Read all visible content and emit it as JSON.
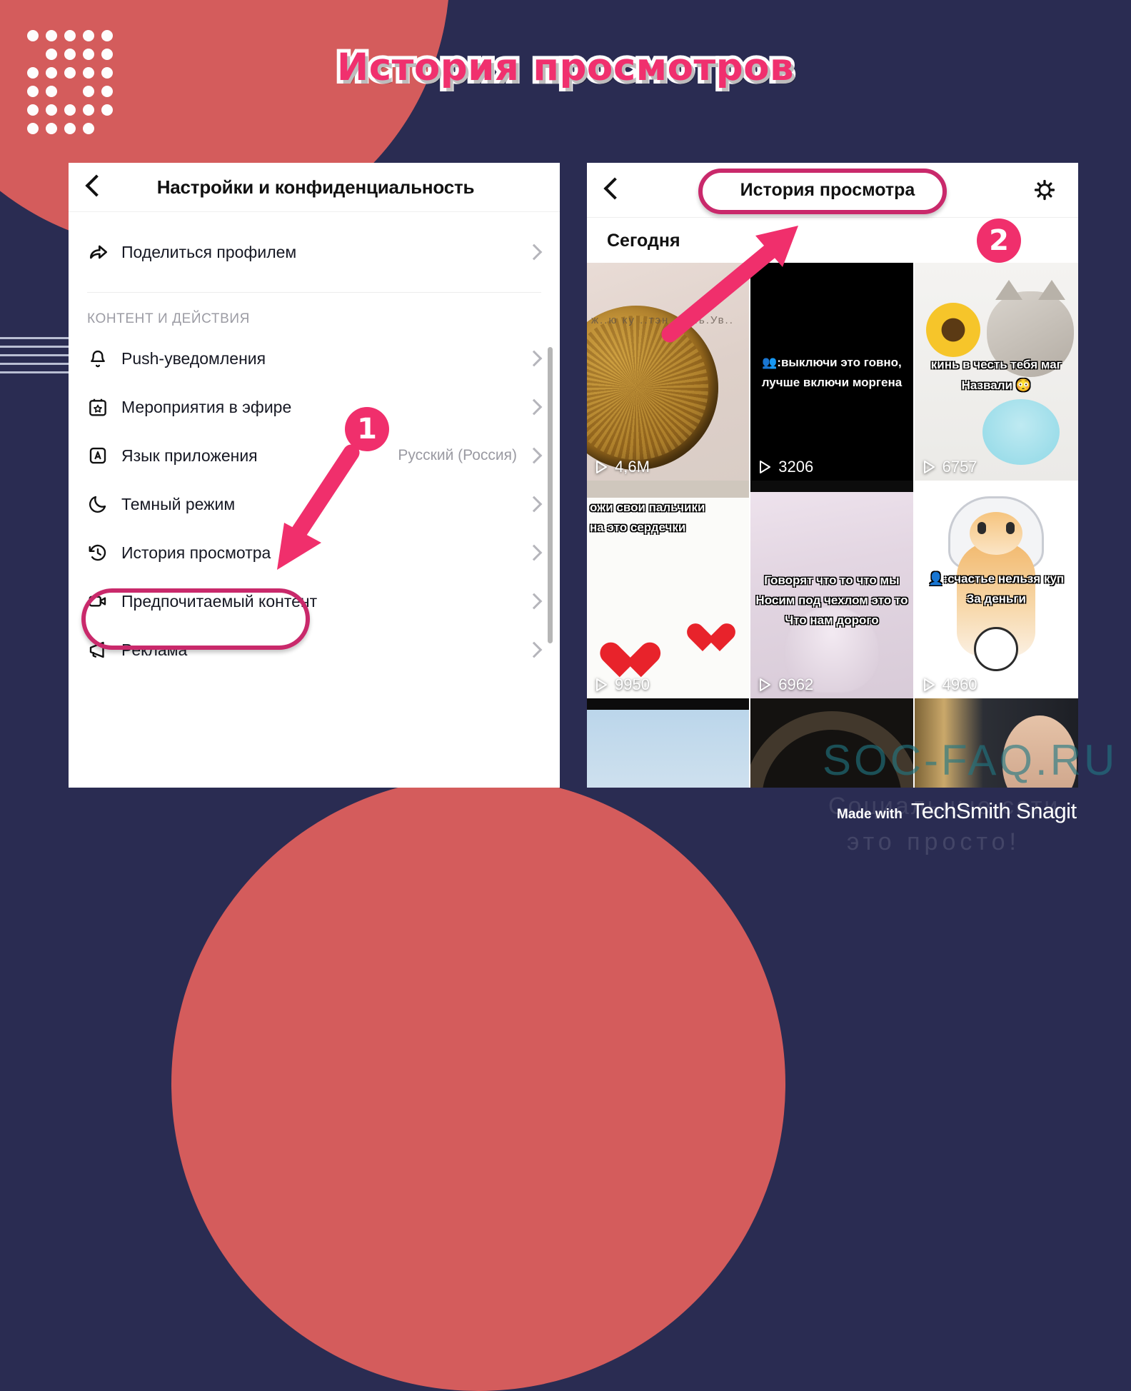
{
  "page": {
    "title": "История просмотров",
    "colors": {
      "background": "#2a2c52",
      "coral": "#d45c5c",
      "accent_pink": "#f02f6c",
      "highlight_outline": "#c9296b"
    }
  },
  "left_phone": {
    "header": {
      "back_icon": "chevron-left-icon",
      "title": "Настройки и конфиденциальность"
    },
    "first_group": [
      {
        "icon": "share-arrow-icon",
        "label": "Поделиться профилем",
        "value": "",
        "chevron": true
      }
    ],
    "group_title": "КОНТЕНТ И ДЕЙСТВИЯ",
    "items": [
      {
        "icon": "bell-icon",
        "label": "Push-уведомления",
        "value": "",
        "chevron": true
      },
      {
        "icon": "calendar-star-icon",
        "label": "Мероприятия в эфире",
        "value": "",
        "chevron": true
      },
      {
        "icon": "language-a-icon",
        "label": "Язык приложения",
        "value": "Русский (Россия)",
        "chevron": true
      },
      {
        "icon": "moon-icon",
        "label": "Темный режим",
        "value": "",
        "chevron": true
      },
      {
        "icon": "clock-history-icon",
        "label": "История просмотра",
        "value": "",
        "chevron": true,
        "highlighted": true
      },
      {
        "icon": "video-camera-icon",
        "label": "Предпочитаемый контент",
        "value": "",
        "chevron": true
      },
      {
        "icon": "megaphone-icon",
        "label": "Реклама",
        "value": "",
        "chevron": true
      }
    ]
  },
  "right_phone": {
    "header": {
      "back_icon": "chevron-left-icon",
      "title": "История просмотра",
      "settings_icon": "gear-icon"
    },
    "section_label": "Сегодня",
    "videos": [
      {
        "views": "4,6M",
        "caption": "ж..ю ку ..тэн .. К.ь.Ув..",
        "caption2": ""
      },
      {
        "views": "3206",
        "caption": "👥:выключи это говно,",
        "caption2": "лучше включи моргена"
      },
      {
        "views": "6757",
        "caption": "кинь в честь тебя маг",
        "caption2": "Назвали 😳"
      },
      {
        "views": "9950",
        "caption": "ожи свои пальчики",
        "caption2": "на это сердечки"
      },
      {
        "views": "6962",
        "caption": "Говорят что то что мы",
        "caption2": "Носим под чехлом это то",
        "caption3": "Что нам дорого"
      },
      {
        "views": "4960",
        "caption": "👤:счастье нельзя куп",
        "caption2": "За деньги"
      },
      {
        "views": "",
        "caption": "",
        "caption2": ""
      },
      {
        "views": "",
        "caption": "",
        "caption2": ""
      },
      {
        "views": "",
        "caption": "",
        "caption2": ""
      }
    ]
  },
  "annotations": {
    "step1": "1",
    "step2": "2"
  },
  "watermarks": {
    "site": "SOC-FAQ.RU",
    "tagline_line1": "Социальные сети",
    "tagline_line2": "это просто!",
    "made_with": "Made with",
    "product": "TechSmith Snagit"
  }
}
